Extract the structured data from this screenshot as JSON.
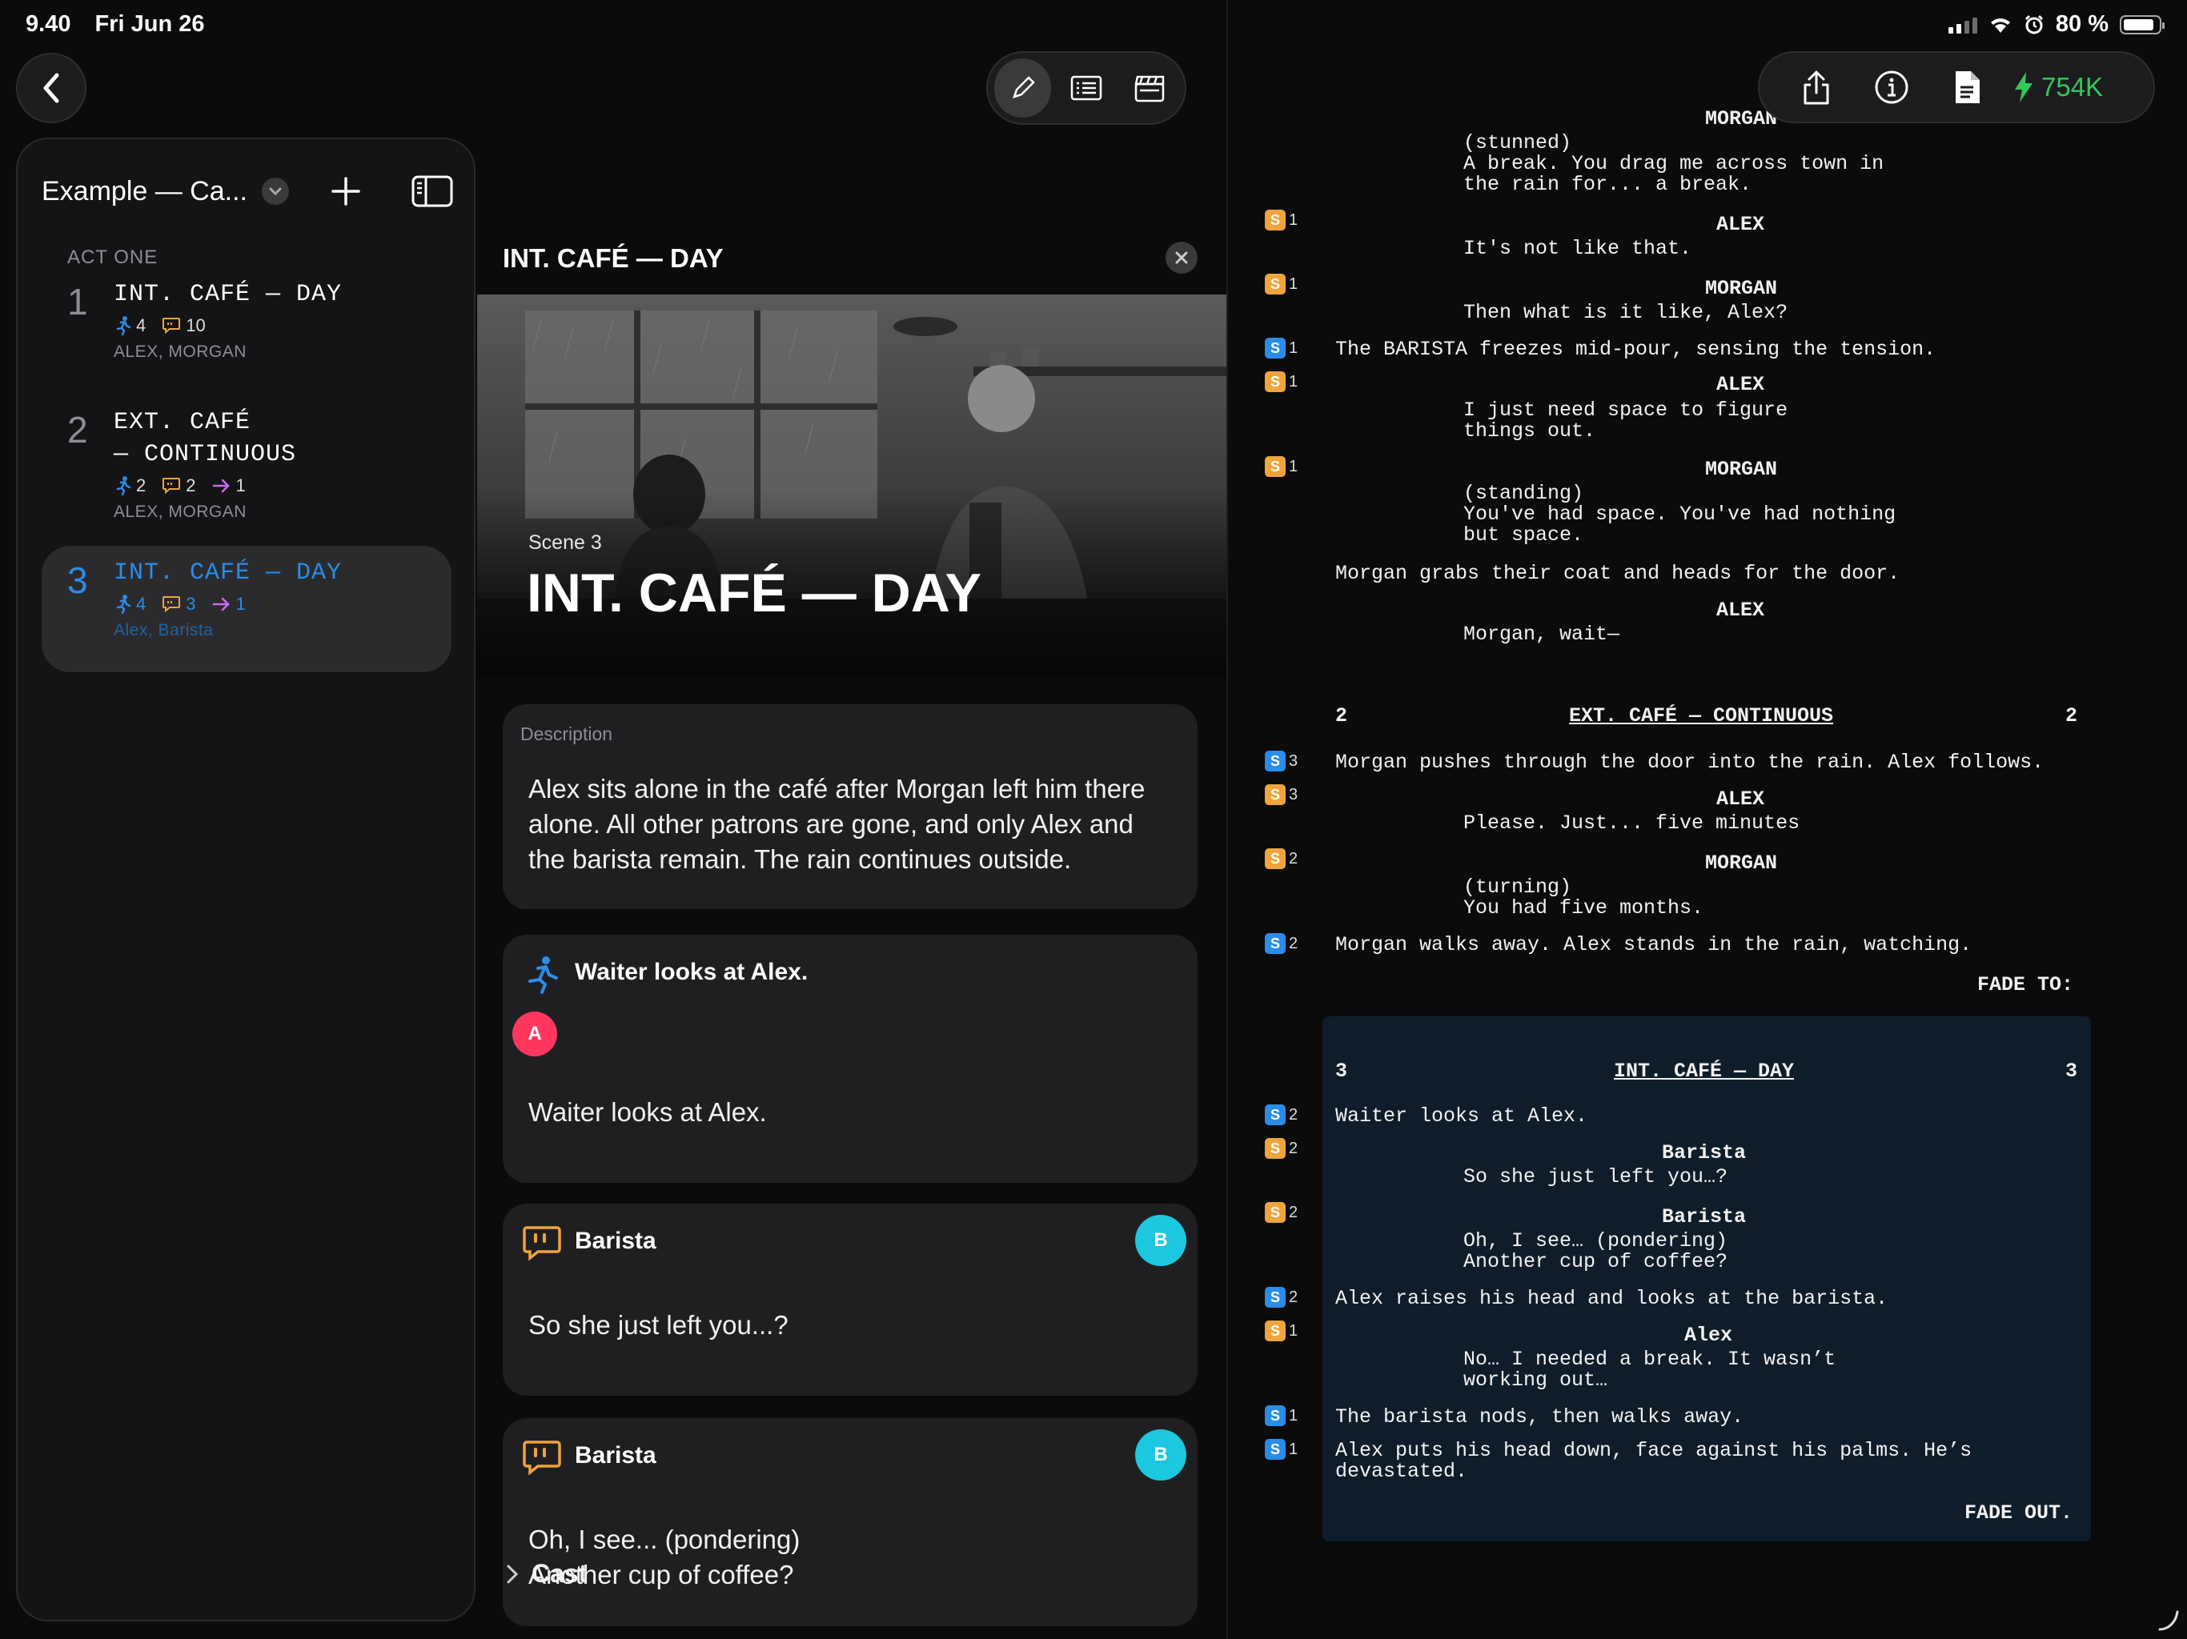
{
  "status_bar": {
    "time": "9.40",
    "date": "Fri Jun 26",
    "battery": "80 %"
  },
  "toolbar": {
    "modes": [
      "pencil-icon",
      "list-icon",
      "clapperboard-icon"
    ],
    "active_mode": "pencil-icon",
    "credits": "754K"
  },
  "sidebar": {
    "project_title": "Example — Ca...",
    "act_label": "ACT ONE",
    "scenes": [
      {
        "number": "1",
        "heading": "INT. CAFÉ — DAY",
        "actions": "4",
        "dialogues": "10",
        "transitions": "",
        "characters": "ALEX, MORGAN"
      },
      {
        "number": "2",
        "heading_line1": "EXT. CAFÉ",
        "heading_line2": "— CONTINUOUS",
        "actions": "2",
        "dialogues": "2",
        "transitions": "1",
        "characters": "ALEX, MORGAN"
      },
      {
        "number": "3",
        "heading": "INT. CAFÉ — DAY",
        "actions": "4",
        "dialogues": "3",
        "transitions": "1",
        "characters": "Alex, Barista"
      }
    ]
  },
  "detail": {
    "title": "INT. CAFÉ — DAY",
    "scene_label": "Scene 3",
    "scene_heading": "INT. CAFÉ — DAY",
    "description_label": "Description",
    "description": "Alex sits alone in the café after Morgan left him there alone. All other patrons are gone, and only Alex and the barista remain. The rain continues outside.",
    "action_card": {
      "title": "Waiter looks at Alex.",
      "avatar": "A",
      "body": "Waiter looks at Alex."
    },
    "dialogue_cards": [
      {
        "character": "Barista",
        "avatar": "B",
        "body": "So she just left you...?"
      },
      {
        "character": "Barista",
        "avatar": "B",
        "body_line1": "Oh, I see... (pondering)",
        "body_line2": "Another cup of coffee?"
      }
    ],
    "cast_label": "Cast"
  },
  "screenplay": {
    "lines": [
      {
        "type": "action",
        "text": "(stunned)",
        "indent": "dial"
      },
      {
        "type": "dialogue",
        "text": "A break. You drag me across town in"
      },
      {
        "type": "dialogue",
        "text": "the rain for... a break."
      }
    ],
    "block1": {
      "char_morgan_top": "MORGAN",
      "paren_stunned": "(stunned)",
      "dlg_break_1": "A break. You drag me across town in",
      "dlg_break_2": "the rain for... a break.",
      "char_alex_1": "ALEX",
      "dlg_not_like": "It's not like that.",
      "char_morgan_2": "MORGAN",
      "dlg_what_is": "Then what is it like, Alex?",
      "act_barista_freezes": "The BARISTA freezes mid-pour, sensing the tension.",
      "char_alex_2": "ALEX",
      "dlg_space_1": "I just need space to figure",
      "dlg_space_2": "things out.",
      "char_morgan_3": "MORGAN",
      "paren_standing": "(standing)",
      "dlg_had_space_1": "You've had space. You've had nothing",
      "dlg_had_space_2": "but space.",
      "act_grabs_coat": "Morgan grabs their coat and heads for the door.",
      "char_alex_3": "ALEX",
      "dlg_wait": "Morgan, wait—"
    },
    "scene2": {
      "number": "2",
      "heading": "EXT. CAFÉ — CONTINUOUS",
      "act_pushes": "Morgan pushes through the door into the rain. Alex follows.",
      "char_alex": "ALEX",
      "dlg_please": "Please. Just... five minutes",
      "char_morgan": "MORGAN",
      "paren_turning": "(turning)",
      "dlg_five_months": "You had five months.",
      "act_walks_away": "Morgan walks away. Alex stands in the rain, watching.",
      "transition": "FADE TO:"
    },
    "scene3": {
      "number": "3",
      "heading": "INT. CAFÉ — DAY",
      "act_waiter": "Waiter looks at Alex.",
      "char_barista_1": "Barista",
      "dlg_left_you": "So she just left you…?",
      "char_barista_2": "Barista",
      "dlg_i_see": "Oh, I see… (pondering)",
      "dlg_another_cup": "Another cup of coffee?",
      "act_raises_head": "Alex raises his head and looks at the barista.",
      "char_alex": "Alex",
      "dlg_needed_break_1": "No… I needed a break. It wasn’t",
      "dlg_needed_break_2": "working out…",
      "act_nods": "The barista nods, then walks away.",
      "act_head_down_1": "Alex puts his head down, face against his palms. He’s",
      "act_head_down_2": "devastated.",
      "transition": "FADE OUT."
    },
    "badges": [
      {
        "color": "orange",
        "count": "1"
      },
      {
        "color": "orange",
        "count": "1"
      },
      {
        "color": "blue",
        "count": "1"
      },
      {
        "color": "orange",
        "count": "1"
      },
      {
        "color": "orange",
        "count": "1"
      },
      {
        "color": "blue",
        "count": "3"
      },
      {
        "color": "orange",
        "count": "3"
      },
      {
        "color": "orange",
        "count": "2"
      },
      {
        "color": "blue",
        "count": "2"
      },
      {
        "color": "blue",
        "count": "2"
      },
      {
        "color": "orange",
        "count": "2"
      },
      {
        "color": "orange",
        "count": "2"
      },
      {
        "color": "blue",
        "count": "2"
      },
      {
        "color": "orange",
        "count": "1"
      },
      {
        "color": "blue",
        "count": "1"
      },
      {
        "color": "blue",
        "count": "1"
      }
    ],
    "badge_letter": "S"
  },
  "colors": {
    "accent_blue": "#2a8de8",
    "orange": "#f0a43c",
    "green": "#34c759",
    "purple": "#c86cf0",
    "avatar_a": "#ff375f",
    "avatar_b": "#1cc8e0"
  }
}
